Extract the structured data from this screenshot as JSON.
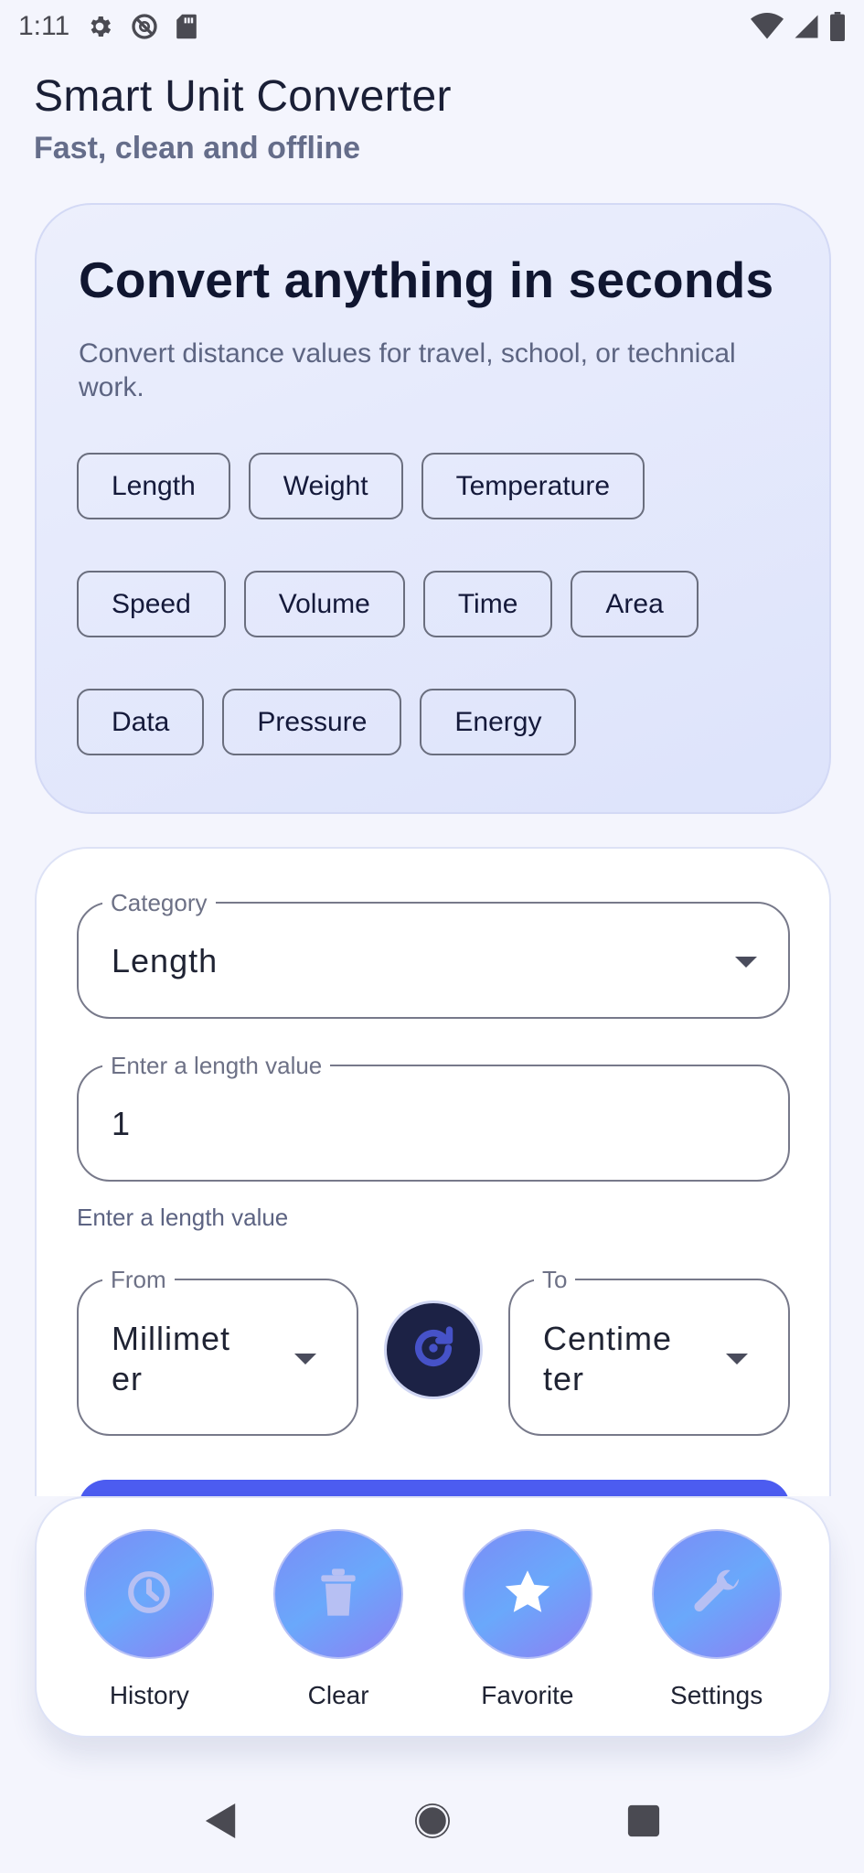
{
  "status_bar": {
    "time": "1:11",
    "left_icons": [
      "gear-icon",
      "no-disturb-icon",
      "sd-card-icon"
    ],
    "right_icons": [
      "wifi-icon",
      "signal-icon",
      "battery-icon"
    ]
  },
  "header": {
    "title": "Smart Unit Converter",
    "subtitle": "Fast, clean and offline"
  },
  "hero": {
    "title": "Convert anything in seconds",
    "description": "Convert distance values for travel, school, or technical work.",
    "chips": [
      [
        "Length",
        "Weight",
        "Temperature"
      ],
      [
        "Speed",
        "Volume",
        "Time",
        "Area"
      ],
      [
        "Data",
        "Pressure",
        "Energy"
      ]
    ]
  },
  "form": {
    "category_label": "Category",
    "category_value": "Length",
    "value_label": "Enter a length value",
    "value": "1",
    "helper_text": "Enter a length value",
    "from_label": "From",
    "from_value_line1": "Millimet",
    "from_value_line2": "er",
    "to_label": "To",
    "to_value_line1": "Centime",
    "to_value_line2": "ter"
  },
  "actions": [
    {
      "label": "History",
      "icon": "clock-icon"
    },
    {
      "label": "Clear",
      "icon": "trash-icon"
    },
    {
      "label": "Favorite",
      "icon": "star-icon"
    },
    {
      "label": "Settings",
      "icon": "wrench-icon"
    }
  ],
  "colors": {
    "background": "#f4f5fd",
    "accent": "#4c5cf0",
    "dark_button": "#1c2245"
  }
}
